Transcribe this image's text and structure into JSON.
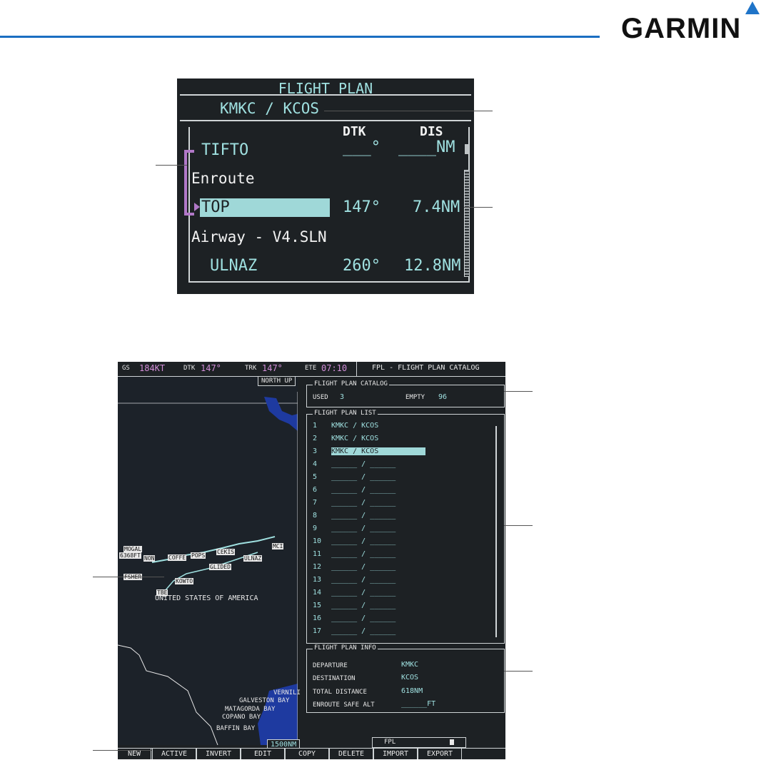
{
  "brand": {
    "logo_text": "GARMIN"
  },
  "fpl_detail": {
    "title": "FLIGHT PLAN",
    "route": "KMKC / KCOS",
    "col_dtk": "DTK",
    "col_dis": "DIS",
    "rows": [
      {
        "name": "TIFTO",
        "dtk": "___°",
        "dis": "____NM"
      },
      {
        "group": "Enroute"
      },
      {
        "name": "TOP",
        "dtk": "147°",
        "dis": "7.4NM",
        "selected": true
      },
      {
        "group": "Airway - V4.SLN"
      },
      {
        "name": "ULNAZ",
        "dtk": "260°",
        "dis": "12.8NM"
      }
    ]
  },
  "mfd": {
    "gs_label": "GS",
    "gs_value": "184KT",
    "dtk_label": "DTK",
    "dtk_value": "147°",
    "trk_label": "TRK",
    "trk_value": "147°",
    "ete_label": "ETE",
    "ete_value": "07:10",
    "page_title": "FPL - FLIGHT PLAN CATALOG",
    "map": {
      "north_up": "NORTH UP",
      "country_label": "UNITED STATES OF AMERICA",
      "scale": "1500NM",
      "labels": [
        "MOGAL",
        "6368FT",
        "NON",
        "COFFE",
        "POPS",
        "CEKIS",
        "MCI",
        "ULNAZ",
        "GLIDED",
        "FSHER",
        "KOWTO",
        "TBE",
        "VERNILI",
        "GALVESTON BAY",
        "MATAGORDA BAY",
        "COPANO BAY",
        "BAFFIN BAY"
      ]
    },
    "catalog": {
      "title": "FLIGHT PLAN CATALOG",
      "used_label": "USED",
      "used_value": "3",
      "empty_label": "EMPTY",
      "empty_value": "96"
    },
    "list": {
      "title": "FLIGHT PLAN LIST",
      "items": [
        {
          "num": "1",
          "name": "KMKC / KCOS"
        },
        {
          "num": "2",
          "name": "KMKC / KCOS"
        },
        {
          "num": "3",
          "name": "KMKC / KCOS",
          "selected": true
        },
        {
          "num": "4",
          "name": "______ / ______"
        },
        {
          "num": "5",
          "name": "______ / ______"
        },
        {
          "num": "6",
          "name": "______ / ______"
        },
        {
          "num": "7",
          "name": "______ / ______"
        },
        {
          "num": "8",
          "name": "______ / ______"
        },
        {
          "num": "9",
          "name": "______ / ______"
        },
        {
          "num": "10",
          "name": "______ / ______"
        },
        {
          "num": "11",
          "name": "______ / ______"
        },
        {
          "num": "12",
          "name": "______ / ______"
        },
        {
          "num": "13",
          "name": "______ / ______"
        },
        {
          "num": "14",
          "name": "______ / ______"
        },
        {
          "num": "15",
          "name": "______ / ______"
        },
        {
          "num": "16",
          "name": "______ / ______"
        },
        {
          "num": "17",
          "name": "______ / ______"
        }
      ]
    },
    "info": {
      "title": "FLIGHT PLAN INFO",
      "departure_label": "DEPARTURE",
      "departure_value": "KMKC",
      "destination_label": "DESTINATION",
      "destination_value": "KCOS",
      "total_distance_label": "TOTAL DISTANCE",
      "total_distance_value": "618NM",
      "esa_label": "ENROUTE SAFE ALT",
      "esa_value": "______FT"
    },
    "status": {
      "fpl_label": "FPL"
    },
    "softkeys": [
      "NEW",
      "ACTIVE",
      "INVERT",
      "EDIT",
      "COPY",
      "DELETE",
      "IMPORT",
      "EXPORT"
    ]
  }
}
